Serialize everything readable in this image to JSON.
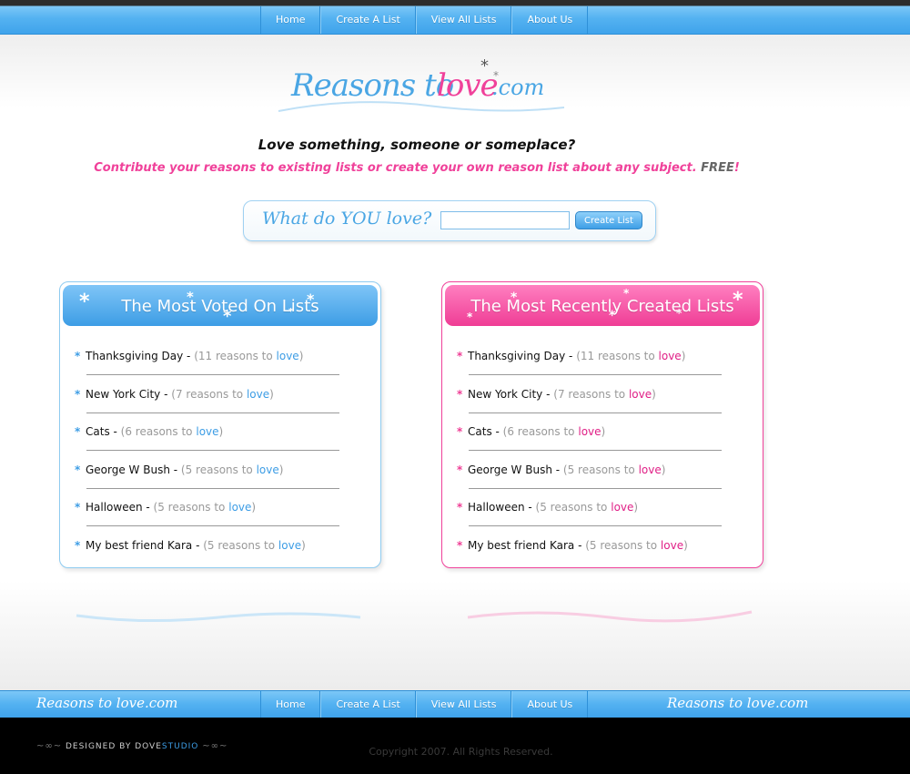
{
  "nav": {
    "items": [
      "Home",
      "Create A List",
      "View All Lists",
      "About Us"
    ]
  },
  "logo": {
    "part1": "Reasons to",
    "part2": "love",
    "part3": ".com"
  },
  "headline": "Love something, someone or someplace?",
  "subline": {
    "text": "Contribute your reasons to existing lists or create your own reason list about any subject.",
    "free": "FREE",
    "bang": "!"
  },
  "search": {
    "prompt": "What do YOU love?",
    "value": "",
    "placeholder": "",
    "button_label": "Create List"
  },
  "most_voted": {
    "title": "The Most Voted On Lists",
    "items": [
      {
        "name": "Thanksgiving Day",
        "count_text": "11 reasons to",
        "love": "love"
      },
      {
        "name": "New York City",
        "count_text": "7 reasons to",
        "love": "love"
      },
      {
        "name": "Cats",
        "count_text": "6 reasons to",
        "love": "love"
      },
      {
        "name": "George W Bush",
        "count_text": "5 reasons to",
        "love": "love"
      },
      {
        "name": "Halloween",
        "count_text": "5 reasons to",
        "love": "love"
      },
      {
        "name": "My best friend Kara",
        "count_text": "5 reasons to",
        "love": "love"
      }
    ]
  },
  "most_recent": {
    "title": "The Most Recently Created Lists",
    "items": [
      {
        "name": "Thanksgiving Day",
        "count_text": "11 reasons to",
        "love": "love"
      },
      {
        "name": "New York City",
        "count_text": "7 reasons to",
        "love": "love"
      },
      {
        "name": "Cats",
        "count_text": "6 reasons to",
        "love": "love"
      },
      {
        "name": "George W Bush",
        "count_text": "5 reasons to",
        "love": "love"
      },
      {
        "name": "Halloween",
        "count_text": "5 reasons to",
        "love": "love"
      },
      {
        "name": "My best friend Kara",
        "count_text": "5 reasons to",
        "love": "love"
      }
    ]
  },
  "footer": {
    "brand": "Reasons to love.com",
    "designed_by": "DESIGNED BY",
    "studio_a": "DOVE",
    "studio_b": "STUDIO",
    "copyright": "Copyright 2007. All Rights Reserved."
  },
  "colors": {
    "blue": "#3d9de5",
    "pink": "#ef3d95"
  }
}
